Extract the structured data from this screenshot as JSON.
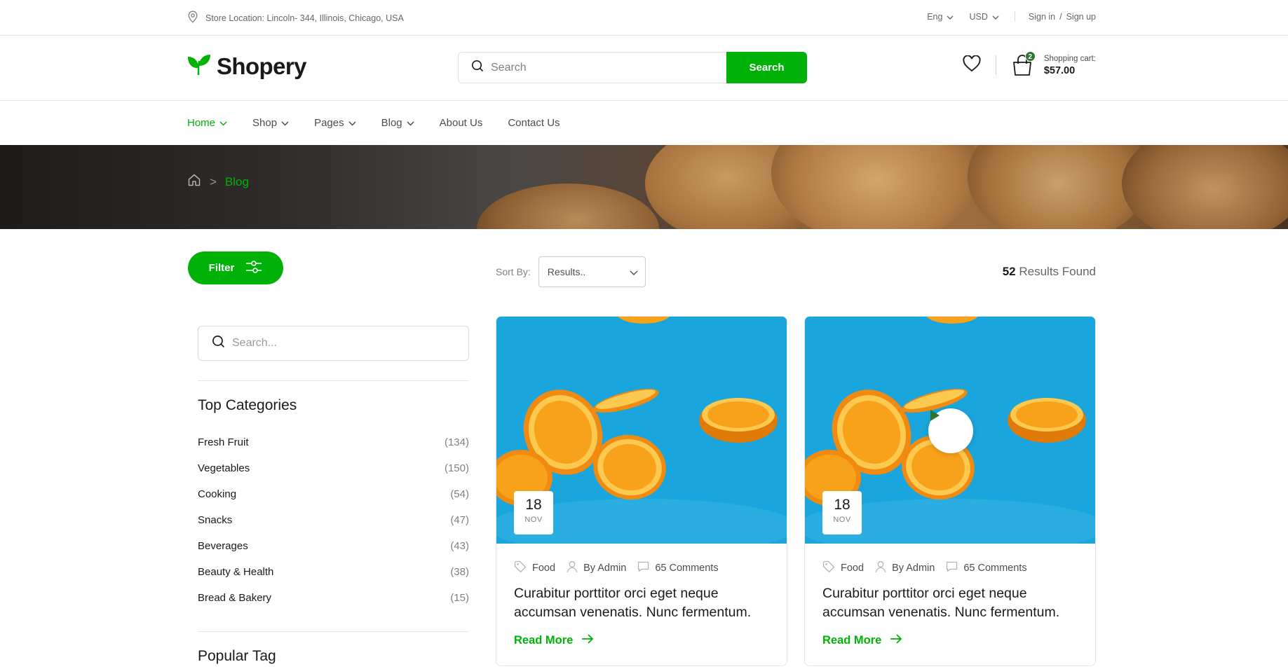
{
  "topbar": {
    "store_location": "Store Location: Lincoln- 344, Illinois, Chicago, USA",
    "language": "Eng",
    "currency": "USD",
    "sign_in": "Sign in",
    "auth_separator": "/",
    "sign_up": "Sign up"
  },
  "header": {
    "logo_text": "Shopery",
    "search_placeholder": "Search",
    "search_button": "Search",
    "cart_count": "2",
    "cart_label": "Shopping cart:",
    "cart_total": "$57.00"
  },
  "nav": {
    "items": [
      "Home",
      "Shop",
      "Pages",
      "Blog",
      "About Us",
      "Contact Us"
    ]
  },
  "breadcrumb": {
    "separator": ">",
    "current": "Blog"
  },
  "toolbar": {
    "filter_label": "Filter",
    "sort_label": "Sort By:",
    "sort_value": "Results..",
    "results_count": "52",
    "results_text": "Results Found"
  },
  "sidebar": {
    "search_placeholder": "Search...",
    "categories_title": "Top Categories",
    "categories": [
      {
        "name": "Fresh Fruit",
        "count": "(134)"
      },
      {
        "name": "Vegetables",
        "count": "(150)"
      },
      {
        "name": "Cooking",
        "count": "(54)"
      },
      {
        "name": "Snacks",
        "count": "(47)"
      },
      {
        "name": "Beverages",
        "count": "(43)"
      },
      {
        "name": "Beauty & Health",
        "count": "(38)"
      },
      {
        "name": "Bread & Bakery",
        "count": "(15)"
      }
    ],
    "tags_title": "Popular Tag"
  },
  "posts": [
    {
      "day": "18",
      "month": "NOV",
      "category": "Food",
      "author": "By Admin",
      "comments": "65 Comments",
      "title": "Curabitur porttitor orci eget neque accumsan venenatis. Nunc fermentum.",
      "read_more": "Read More",
      "has_video": false
    },
    {
      "day": "18",
      "month": "NOV",
      "category": "Food",
      "author": "By Admin",
      "comments": "65 Comments",
      "title": "Curabitur porttitor orci eget neque accumsan venenatis. Nunc fermentum.",
      "read_more": "Read More",
      "has_video": true
    }
  ],
  "colors": {
    "brand_green": "#00b207",
    "dark_green": "#2c742f",
    "image_blue": "#1aa5dd"
  },
  "icons": [
    "location-pin-icon",
    "chevron-down-icon",
    "leaf-logo-icon",
    "search-icon",
    "heart-icon",
    "shopping-bag-icon",
    "home-icon",
    "filter-sliders-icon",
    "tag-icon",
    "user-icon",
    "comment-icon",
    "arrow-right-icon",
    "play-icon"
  ]
}
